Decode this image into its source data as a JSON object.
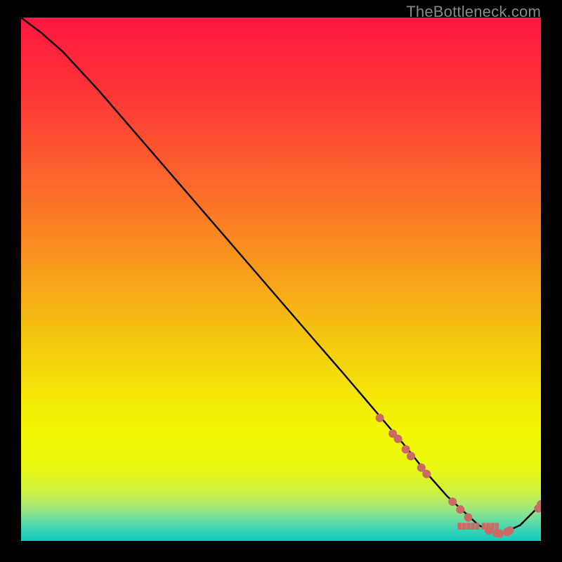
{
  "attribution": "TheBottleneck.com",
  "chart_data": {
    "type": "line",
    "title": "",
    "xlabel": "",
    "ylabel": "",
    "xlim": [
      0,
      100
    ],
    "ylim": [
      0,
      100
    ],
    "grid": false,
    "series": [
      {
        "name": "curve",
        "x": [
          0,
          4,
          8,
          15,
          25,
          35,
          45,
          55,
          62,
          68,
          74,
          78,
          82,
          88,
          92,
          96,
          100
        ],
        "y": [
          100,
          97,
          93.5,
          86,
          74.5,
          63,
          51.5,
          40,
          32,
          25,
          18,
          13,
          8.5,
          3,
          1.2,
          3,
          7
        ],
        "color": "#000000",
        "style": "solid"
      }
    ],
    "markers": [
      {
        "x": 69,
        "y": 23.5,
        "label": ""
      },
      {
        "x": 71.5,
        "y": 20.5,
        "label": ""
      },
      {
        "x": 72.5,
        "y": 19.5,
        "label": ""
      },
      {
        "x": 74,
        "y": 17.5,
        "label": ""
      },
      {
        "x": 75,
        "y": 16.2,
        "label": ""
      },
      {
        "x": 77,
        "y": 14,
        "label": ""
      },
      {
        "x": 78,
        "y": 12.8,
        "label": ""
      },
      {
        "x": 83,
        "y": 7.5,
        "label": ""
      },
      {
        "x": 84.5,
        "y": 6,
        "label": ""
      },
      {
        "x": 86,
        "y": 4.5,
        "label": ""
      },
      {
        "x": 90,
        "y": 2,
        "label": ""
      },
      {
        "x": 91.5,
        "y": 1.5,
        "label": ""
      },
      {
        "x": 92,
        "y": 1.4,
        "label": ""
      },
      {
        "x": 93.5,
        "y": 1.7,
        "label": ""
      },
      {
        "x": 94,
        "y": 2,
        "label": ""
      },
      {
        "x": 99.5,
        "y": 6.2,
        "label": ""
      },
      {
        "x": 100,
        "y": 7,
        "label": ""
      }
    ],
    "marker_label": {
      "x": 88,
      "y": 2.5
    },
    "marker_color": "#cb6a65",
    "background_gradient": {
      "stops": [
        {
          "pos": 0.0,
          "color": "#fe173e"
        },
        {
          "pos": 0.12,
          "color": "#fe2f39"
        },
        {
          "pos": 0.25,
          "color": "#fd5430"
        },
        {
          "pos": 0.38,
          "color": "#fb7b26"
        },
        {
          "pos": 0.5,
          "color": "#f8a21a"
        },
        {
          "pos": 0.62,
          "color": "#f5c90f"
        },
        {
          "pos": 0.74,
          "color": "#f3eb06"
        },
        {
          "pos": 0.8,
          "color": "#f4f704"
        },
        {
          "pos": 0.86,
          "color": "#eaf813"
        },
        {
          "pos": 0.905,
          "color": "#cff13f"
        },
        {
          "pos": 0.935,
          "color": "#a5e878"
        },
        {
          "pos": 0.96,
          "color": "#69dca2"
        },
        {
          "pos": 0.985,
          "color": "#2dd1ba"
        },
        {
          "pos": 1.0,
          "color": "#10cbb9"
        }
      ]
    }
  }
}
